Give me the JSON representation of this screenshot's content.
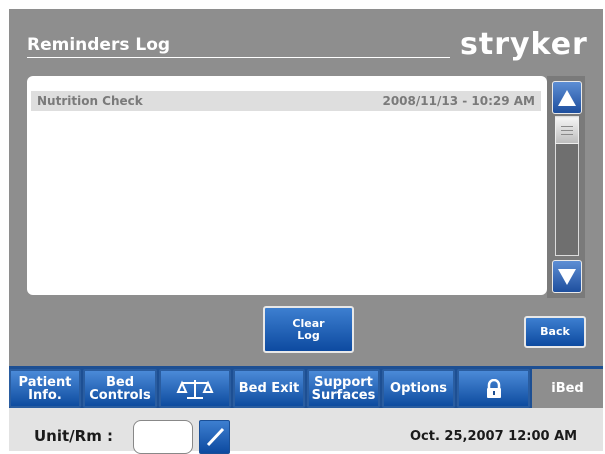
{
  "header": {
    "title": "Reminders Log",
    "brand": "stryker"
  },
  "log": {
    "entries": [
      {
        "name": "Nutrition Check",
        "datetime": "2008/11/13 - 10:29 AM"
      }
    ]
  },
  "actions": {
    "clear_line1": "Clear",
    "clear_line2": "Log",
    "back": "Back"
  },
  "nav": {
    "patient_line1": "Patient",
    "patient_line2": "Info.",
    "bedctl_line1": "Bed",
    "bedctl_line2": "Controls",
    "scale_icon": "scale-icon",
    "bed_exit": "Bed Exit",
    "support_line1": "Support",
    "support_line2": "Surfaces",
    "options": "Options",
    "lock_icon": "lock-icon",
    "ibed": "iBed"
  },
  "status": {
    "unit_label": "Unit/Rm :",
    "unit_value": "",
    "datetime": "Oct. 25,2007  12:00 AM"
  },
  "colors": {
    "panel": "#8e8e8e",
    "button_blue": "#0d4aa0",
    "nav_bg": "#1d4f93"
  }
}
